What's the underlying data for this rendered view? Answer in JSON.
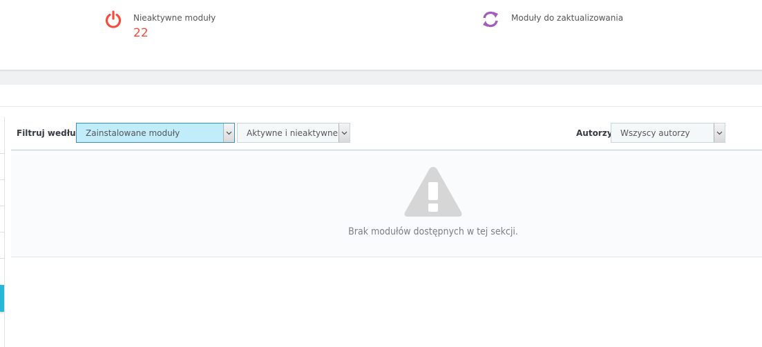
{
  "kpis": {
    "inactive": {
      "title": "Nieaktywne moduły",
      "value": "22",
      "icon": "power-icon",
      "color": "#f54c3e"
    },
    "to_update": {
      "title": "Moduły do zaktualizowania",
      "icon": "refresh-icon",
      "color": "#a15ebd"
    }
  },
  "filters": {
    "filter_by_label": "Filtruj według",
    "installed_select": {
      "value": "Zainstalowane moduły"
    },
    "status_select": {
      "value": "Aktywne i nieaktywne"
    },
    "authors_label": "Autorzy",
    "authors_select": {
      "value": "Wszyscy autorzy"
    }
  },
  "empty_state": {
    "icon": "warning-icon",
    "message": "Brak modułów dostępnych w tej sekcji."
  },
  "colors": {
    "accent": "#25b9d7",
    "danger": "#f54c3e",
    "purple": "#a15ebd"
  }
}
